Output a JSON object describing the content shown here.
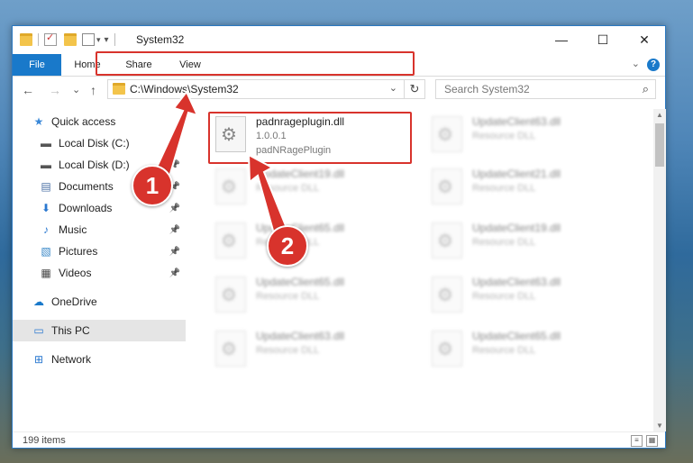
{
  "window": {
    "title": "System32",
    "controls": {
      "minimize": "—",
      "maximize": "☐",
      "close": "✕"
    }
  },
  "ribbon": {
    "tabs": [
      "File",
      "Home",
      "Share",
      "View"
    ]
  },
  "navbar": {
    "back": "←",
    "forward": "→",
    "recent": "⌄",
    "up": "↑",
    "address": "C:\\Windows\\System32",
    "search_placeholder": "Search System32"
  },
  "sidebar": {
    "items": [
      {
        "label": "Quick access",
        "icon": "star-icon",
        "glyph": "★",
        "color": "#3a88d8",
        "pinned": false
      },
      {
        "label": "Local Disk (C:)",
        "icon": "drive-icon",
        "glyph": "▬",
        "color": "#555555",
        "pinned": true
      },
      {
        "label": "Local Disk (D:)",
        "icon": "drive-icon",
        "glyph": "▬",
        "color": "#555555",
        "pinned": true
      },
      {
        "label": "Documents",
        "icon": "document-icon",
        "glyph": "▤",
        "color": "#4a6fa5",
        "pinned": true
      },
      {
        "label": "Downloads",
        "icon": "download-icon",
        "glyph": "⬇",
        "color": "#2a78d0",
        "pinned": true
      },
      {
        "label": "Music",
        "icon": "music-icon",
        "glyph": "♪",
        "color": "#2a78d0",
        "pinned": true
      },
      {
        "label": "Pictures",
        "icon": "pictures-icon",
        "glyph": "▧",
        "color": "#3a88c8",
        "pinned": true
      },
      {
        "label": "Videos",
        "icon": "video-icon",
        "glyph": "▦",
        "color": "#444444",
        "pinned": true
      },
      {
        "label": "OneDrive",
        "icon": "cloud-icon",
        "glyph": "☁",
        "color": "#1979ca",
        "pinned": false
      },
      {
        "label": "This PC",
        "icon": "computer-icon",
        "glyph": "▭",
        "color": "#2a78d0",
        "pinned": false,
        "selected": true
      },
      {
        "label": "Network",
        "icon": "network-icon",
        "glyph": "⊞",
        "color": "#2a78d0",
        "pinned": false
      }
    ]
  },
  "files": {
    "main": {
      "name": "padnrageplugin.dll",
      "version": "1.0.0.1",
      "description": "padNRagePlugin"
    },
    "blurred": [
      {
        "name": "UpdateClient63.dll",
        "type": "Resource DLL"
      },
      {
        "name": "UpdateClient19.dll",
        "type": "Resource DLL"
      },
      {
        "name": "UpdateClient21.dll",
        "type": "Resource DLL"
      },
      {
        "name": "UpdateClient65.dll",
        "type": "Resource DLL"
      },
      {
        "name": "UpdateClient19.dll",
        "type": "Resource DLL"
      },
      {
        "name": "UpdateClient65.dll",
        "type": "Resource DLL"
      },
      {
        "name": "UpdateClient63.dll",
        "type": "Resource DLL"
      },
      {
        "name": "UpdateClient63.dll",
        "type": "Resource DLL"
      },
      {
        "name": "UpdateClient65.dll",
        "type": "Resource DLL"
      }
    ]
  },
  "annotations": {
    "step1": "1",
    "step2": "2",
    "color": "#d8332c"
  },
  "status": {
    "count": "199 items"
  }
}
